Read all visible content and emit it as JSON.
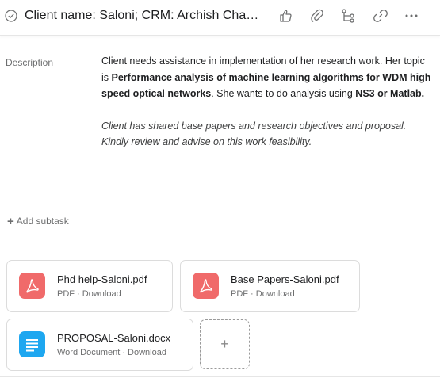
{
  "header": {
    "title": "Client name: Saloni; CRM: Archish Chaudhary",
    "icons": [
      "check-circle-icon",
      "thumbs-up-icon",
      "paperclip-icon",
      "subtask-icon",
      "link-icon",
      "more-icon"
    ]
  },
  "description": {
    "label": "Description",
    "p1": {
      "t1": "Client needs assistance in implementation of her research work. Her topic is ",
      "b1": "Performance analysis of machine learning algorithms for WDM high speed optical networks",
      "t2": ". She wants to do analysis using ",
      "b2": "NS3 or Matlab."
    },
    "p2": "Client has shared base papers and research objectives and proposal. Kindly review and advise on this work feasibility."
  },
  "subtask": {
    "label": "Add subtask"
  },
  "attachments": [
    {
      "name": "Phd help-Saloni.pdf",
      "meta": "PDF · Download",
      "icon": "pdf-icon",
      "color": "#f06a6a"
    },
    {
      "name": "Base Papers-Saloni.pdf",
      "meta": "PDF · Download",
      "icon": "pdf-icon",
      "color": "#f06a6a"
    },
    {
      "name": "PROPOSAL-Saloni.docx",
      "meta": "Word Document · Download",
      "icon": "word-doc-icon",
      "color": "#1ea7f0"
    }
  ],
  "add_attachment": {
    "label": "+"
  }
}
